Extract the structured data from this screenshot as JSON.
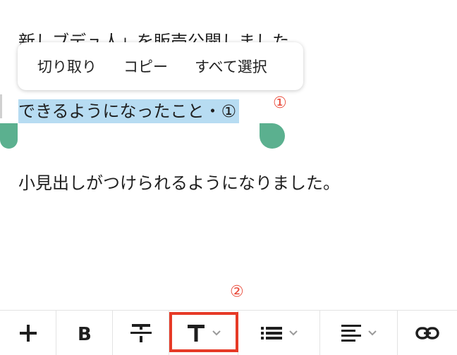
{
  "editor": {
    "partial_line": "新しブデュ人」を販売公開しました",
    "selected_line": "できるようになったこと・①",
    "heading_line": "小見出しがつけられるようになりました。"
  },
  "context_menu": {
    "items": [
      {
        "label": "切り取り"
      },
      {
        "label": "コピー"
      },
      {
        "label": "すべて選択"
      }
    ]
  },
  "annotations": {
    "one": "①",
    "two": "②"
  },
  "toolbar": {
    "buttons": [
      "add",
      "bold",
      "strikethrough",
      "text-style",
      "list",
      "align",
      "link"
    ]
  },
  "colors": {
    "selection": "#b7dcf2",
    "handle": "#5bb08f",
    "annotation": "#e94a3a",
    "highlight_box": "#e63a27"
  }
}
